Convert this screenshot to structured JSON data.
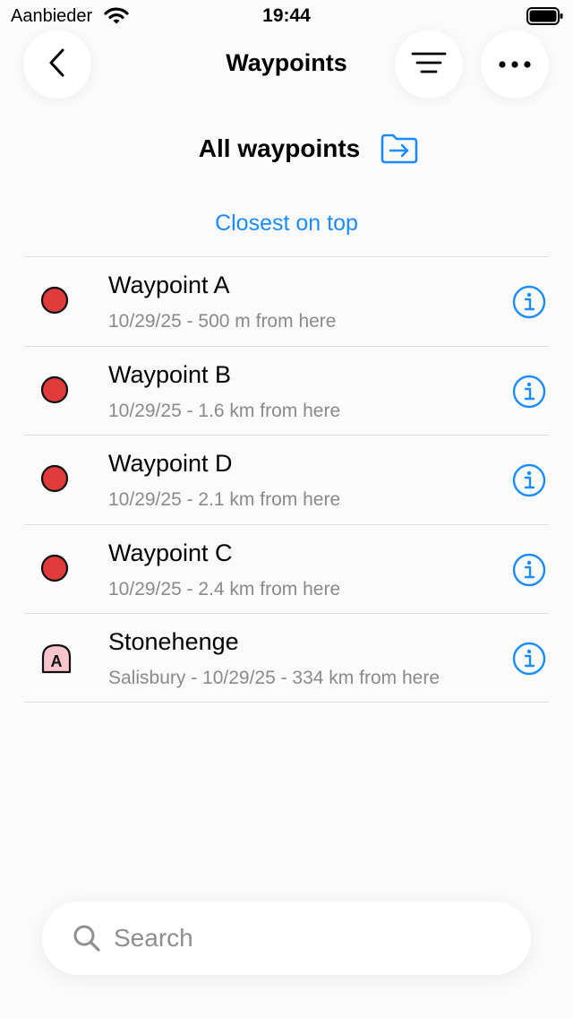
{
  "status_bar": {
    "carrier": "Aanbieder",
    "time": "19:44",
    "icons": [
      "wifi-icon",
      "battery-icon"
    ]
  },
  "header": {
    "title": "Waypoints",
    "icons": [
      "chevron-left-icon",
      "filter-lines-icon",
      "ellipsis-icon"
    ]
  },
  "folder": {
    "title": "All waypoints",
    "icon": "folder-arrow-icon"
  },
  "sort": {
    "label": "Closest on top"
  },
  "waypoints": [
    {
      "title": "Waypoint A",
      "subtitle": "10/29/25 - 500 m from here",
      "marker": "red-dot"
    },
    {
      "title": "Waypoint B",
      "subtitle": "10/29/25 - 1.6 km from here",
      "marker": "red-dot"
    },
    {
      "title": "Waypoint D",
      "subtitle": "10/29/25 - 2.1 km from here",
      "marker": "red-dot"
    },
    {
      "title": "Waypoint C",
      "subtitle": "10/29/25 - 2.4 km from here",
      "marker": "red-dot"
    },
    {
      "title": "Stonehenge",
      "subtitle": "Salisbury - 10/29/25 - 334 km from here",
      "marker": "letter-a-badge",
      "marker_letter": "A"
    }
  ],
  "search": {
    "placeholder": "Search",
    "value": ""
  },
  "colors": {
    "accent": "#1a8cff",
    "marker_red": "#e03a3a",
    "marker_pink": "#f8c5cd",
    "subtitle_gray": "#8a8a8a"
  }
}
